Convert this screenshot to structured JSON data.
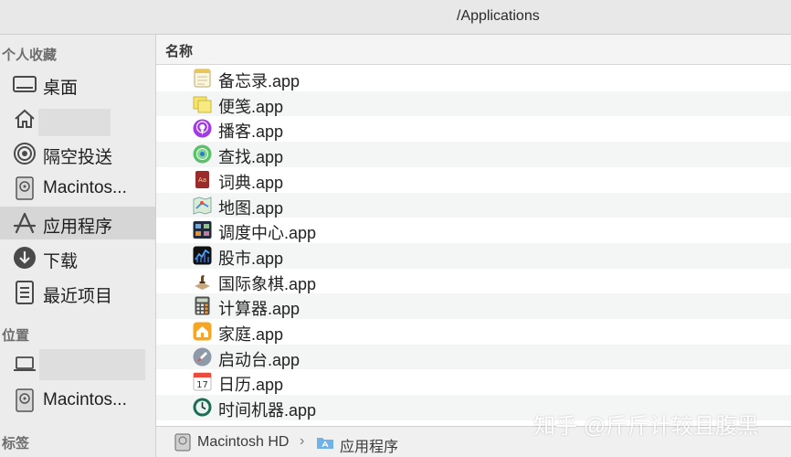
{
  "window": {
    "title": "/Applications"
  },
  "sidebar": {
    "favorites_header": "个人收藏",
    "favorites": [
      {
        "label": "桌面",
        "icon": "desktop-icon"
      },
      {
        "label": "",
        "icon": "home-icon"
      },
      {
        "label": "隔空投送",
        "icon": "airdrop-icon"
      },
      {
        "label": "Macintos...",
        "icon": "disk-icon"
      },
      {
        "label": "应用程序",
        "icon": "applications-icon",
        "selected": true
      },
      {
        "label": "下载",
        "icon": "downloads-icon"
      },
      {
        "label": "最近项目",
        "icon": "recents-icon"
      }
    ],
    "locations_header": "位置",
    "locations": [
      {
        "label": "",
        "icon": "laptop-icon"
      },
      {
        "label": "Macintos...",
        "icon": "disk-icon"
      }
    ],
    "tags_header": "标签"
  },
  "file_list": {
    "column_name": "名称",
    "files": [
      {
        "name": "备忘录.app",
        "icon": "notes-icon"
      },
      {
        "name": "便笺.app",
        "icon": "stickies-icon"
      },
      {
        "name": "播客.app",
        "icon": "podcasts-icon"
      },
      {
        "name": "查找.app",
        "icon": "findmy-icon"
      },
      {
        "name": "词典.app",
        "icon": "dictionary-icon"
      },
      {
        "name": "地图.app",
        "icon": "maps-icon"
      },
      {
        "name": "调度中心.app",
        "icon": "mission-control-icon"
      },
      {
        "name": "股市.app",
        "icon": "stocks-icon"
      },
      {
        "name": "国际象棋.app",
        "icon": "chess-icon"
      },
      {
        "name": "计算器.app",
        "icon": "calculator-icon"
      },
      {
        "name": "家庭.app",
        "icon": "home-app-icon"
      },
      {
        "name": "启动台.app",
        "icon": "launchpad-icon"
      },
      {
        "name": "日历.app",
        "icon": "calendar-icon"
      },
      {
        "name": "时间机器.app",
        "icon": "time-machine-icon"
      }
    ]
  },
  "path_bar": {
    "items": [
      "Macintosh HD",
      "应用程序"
    ],
    "separator": "›"
  },
  "calendar_day": "17",
  "watermark": "知乎 @斤斤计较且腹黑"
}
